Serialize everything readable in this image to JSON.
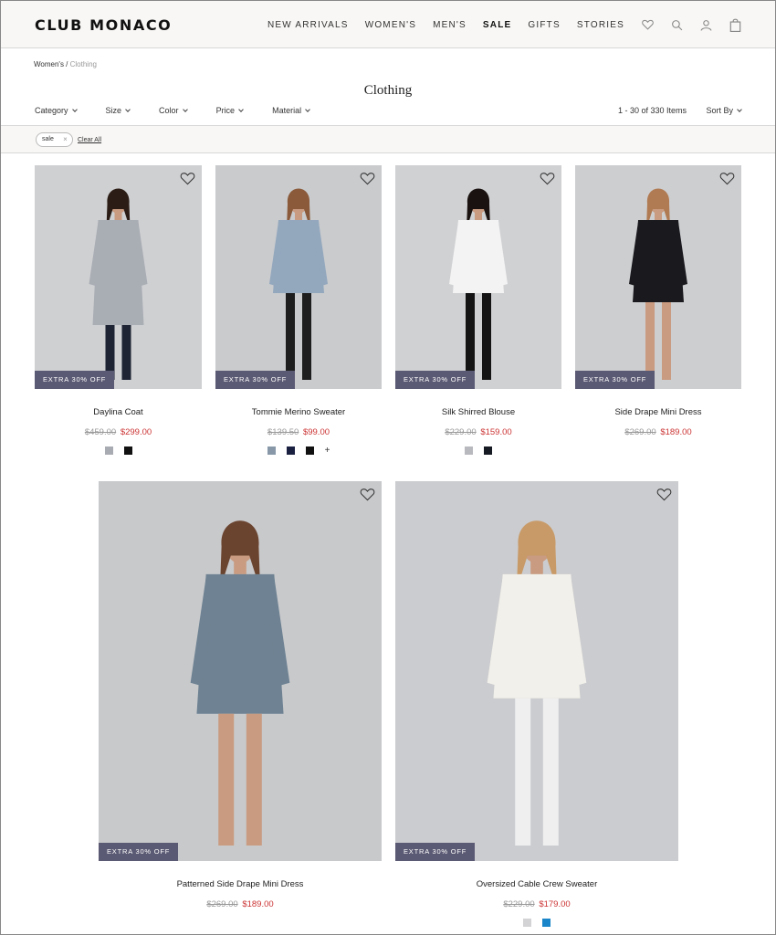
{
  "brand": "CLUB MONACO",
  "nav": [
    "NEW ARRIVALS",
    "WOMEN'S",
    "MEN'S",
    "SALE",
    "GIFTS",
    "STORIES"
  ],
  "nav_bold": "SALE",
  "icons": [
    "heart-icon",
    "search-icon",
    "user-icon",
    "bag-icon"
  ],
  "breadcrumb": {
    "parent": "Women's",
    "sep": " / ",
    "current": "Clothing"
  },
  "title": "Clothing",
  "filters": [
    "Category",
    "Size",
    "Color",
    "Price",
    "Material"
  ],
  "results": "1 - 30 of 330 Items",
  "sort": "Sort By",
  "active_filter": {
    "chip": "sale",
    "remove": "×",
    "clear": "Clear All"
  },
  "badge_text": "EXTRA 30% OFF",
  "products": [
    {
      "name": "Daylina Coat",
      "old": "$459.00",
      "new": "$299.00",
      "swatches": [
        "#a9abb3",
        "#111111"
      ],
      "more": "",
      "bg": "#cfd0d2"
    },
    {
      "name": "Tommie Merino Sweater",
      "old": "$139.50",
      "new": "$99.00",
      "swatches": [
        "#8898a8",
        "#1a2040",
        "#111111"
      ],
      "more": "+",
      "bg": "#c9cbcd"
    },
    {
      "name": "Silk Shirred Blouse",
      "old": "$229.00",
      "new": "$159.00",
      "swatches": [
        "#b8b9be",
        "#161a22"
      ],
      "more": "",
      "bg": "#d0d1d3"
    },
    {
      "name": "Side Drape Mini Dress",
      "old": "$269.00",
      "new": "$189.00",
      "swatches": [],
      "more": "",
      "bg": "#cdced0"
    },
    {
      "name": "Patterned Side Drape Mini Dress",
      "old": "$269.00",
      "new": "$189.00",
      "swatches": [],
      "more": "",
      "bg": "#c8c9cb"
    },
    {
      "name": "Oversized Cable Crew Sweater",
      "old": "$229.00",
      "new": "$179.00",
      "swatches": [
        "#d3d3d5",
        "#1a86c9"
      ],
      "more": "",
      "bg": "#cbcccf"
    }
  ]
}
